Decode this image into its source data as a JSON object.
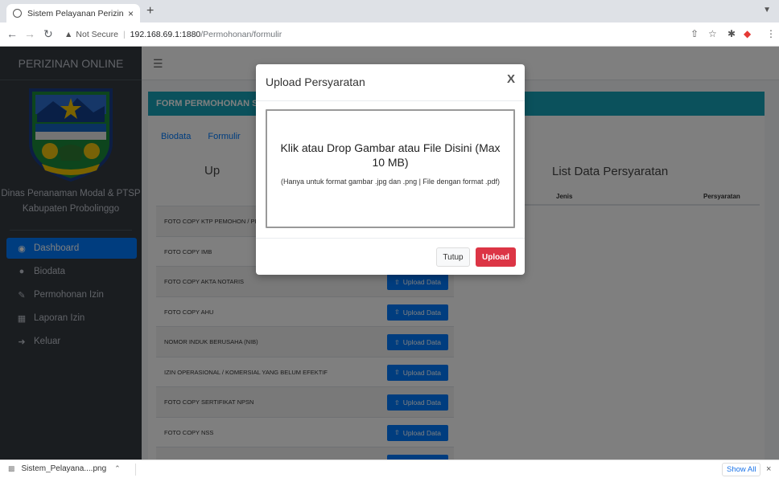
{
  "browser": {
    "tab_title": "Sistem Pelayanan Perizinan On",
    "tab_close": "×",
    "new_tab": "+",
    "url_warning": "Not Secure",
    "url_host": "192.168.69.1:1880",
    "url_path": "/Permohonan/formulir"
  },
  "sidebar": {
    "brand": "PERIZINAN ONLINE",
    "org_line1": "Dinas Penanaman Modal & PTSP",
    "org_line2": "Kabupaten Probolinggo",
    "items": [
      {
        "label": "Dashboard",
        "icon": "dashboard-icon",
        "active": true
      },
      {
        "label": "Biodata",
        "icon": "user-icon",
        "active": false
      },
      {
        "label": "Permohonan Izin",
        "icon": "edit-icon",
        "active": false
      },
      {
        "label": "Laporan Izin",
        "icon": "table-icon",
        "active": false
      },
      {
        "label": "Keluar",
        "icon": "sign-out-icon",
        "active": false
      }
    ]
  },
  "main": {
    "card_title": "FORM PERMOHONAN SU",
    "tabs": [
      "Biodata",
      "Formulir"
    ],
    "section_left": "Up",
    "section_right": "List Data Persyaratan",
    "right_table": {
      "col_jenis": "Jenis",
      "col_persyaratan": "Persyaratan"
    },
    "upload_label": "Upload Data",
    "rows": [
      {
        "label": "FOTO COPY KTP PEMOHON / PEN"
      },
      {
        "label": "FOTO COPY IMB"
      },
      {
        "label": "FOTO COPY AKTA NOTARIS"
      },
      {
        "label": "FOTO COPY AHU"
      },
      {
        "label": "NOMOR INDUK BERUSAHA (NIB)"
      },
      {
        "label": "IZIN OPERASIONAL / KOMERSIAL YANG BELUM EFEKTIF"
      },
      {
        "label": "FOTO COPY SERTIFIKAT NPSN"
      },
      {
        "label": "FOTO COPY NSS"
      }
    ]
  },
  "modal": {
    "title": "Upload Persyaratan",
    "close": "X",
    "drop_main": "Klik atau Drop Gambar atau File Disini (Max 10 MB)",
    "drop_sub": "(Hanya untuk format gambar .jpg dan .png | File dengan format .pdf)",
    "btn_tutup": "Tutup",
    "btn_upload": "Upload"
  },
  "downloads": {
    "file": "Sistem_Pelayana....png",
    "show_all": "Show All",
    "close": "×"
  },
  "colors": {
    "sidebar": "#343a40",
    "active": "#007bff",
    "card_header": "#17a2b8",
    "upload_button": "#dc3545"
  }
}
